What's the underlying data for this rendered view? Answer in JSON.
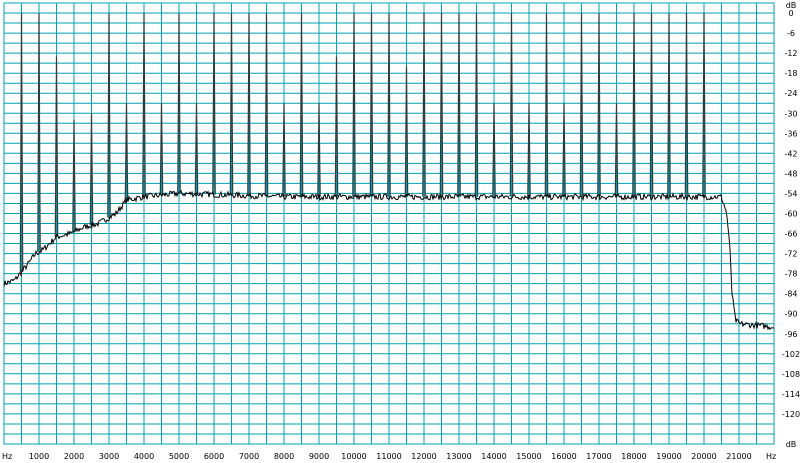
{
  "chart_data": {
    "type": "line",
    "title": "",
    "xlabel": "Hz",
    "ylabel": "dB",
    "x_unit_left": "Hz",
    "x_unit_right": "Hz",
    "y_unit_top": "dB",
    "y_unit_bottom": "dB",
    "xlim": [
      0,
      22000
    ],
    "ylim": [
      -129,
      3
    ],
    "x_ticks": [
      1000,
      2000,
      3000,
      4000,
      5000,
      6000,
      7000,
      8000,
      9000,
      10000,
      11000,
      12000,
      13000,
      14000,
      15000,
      16000,
      17000,
      18000,
      19000,
      20000,
      21000
    ],
    "x_tick_labels": [
      "1000",
      "2000",
      "3000",
      "4000",
      "5000",
      "6000",
      "7000",
      "8000",
      "9000",
      "10000",
      "11000",
      "12000",
      "13000",
      "14000",
      "15000",
      "16000",
      "17000",
      "18000",
      "19000",
      "20000",
      "21000"
    ],
    "y_ticks": [
      0,
      -6,
      -12,
      -18,
      -24,
      -30,
      -36,
      -42,
      -48,
      -54,
      -60,
      -66,
      -72,
      -78,
      -84,
      -90,
      -96,
      -102,
      -108,
      -114,
      -120
    ],
    "y_tick_labels": [
      "0",
      "-6",
      "-12",
      "-18",
      "-24",
      "-30",
      "-36",
      "-42",
      "-48",
      "-54",
      "-60",
      "-66",
      "-72",
      "-78",
      "-84",
      "-90",
      "-96",
      "-102",
      "-108",
      "-114",
      "-120"
    ],
    "grid": true,
    "colors": {
      "grid": "#00a0b4",
      "line": "#000000",
      "peak": "#283c3c",
      "background": "#ffffff"
    },
    "noise_floor": {
      "x": [
        0,
        300,
        700,
        900,
        1100,
        1500,
        1900,
        2300,
        2700,
        3200,
        3500,
        4000,
        5000,
        8000,
        12000,
        16000,
        20000,
        20500,
        20650,
        20750,
        20800,
        20900,
        21000,
        22000
      ],
      "y": [
        -81,
        -80,
        -75,
        -72,
        -71,
        -67,
        -66,
        -64,
        -63,
        -60,
        -56,
        -55,
        -54,
        -55,
        -55,
        -55,
        -55,
        -55,
        -60,
        -72,
        -84,
        -92,
        -93,
        -94
      ]
    },
    "series": [
      {
        "x": [
          500,
          1000,
          1500,
          2000,
          2500,
          3000,
          3500,
          4000,
          4500,
          5000,
          5500,
          6000,
          6500,
          7000,
          7500,
          8000,
          8500,
          9000,
          9500,
          10000,
          10500,
          11000,
          11500,
          12000,
          12500,
          13000,
          13500,
          14000,
          14500,
          15000,
          15500,
          16000,
          16500,
          17000,
          17500,
          18000,
          18500,
          19000,
          19500,
          20000
        ],
        "y": [
          0,
          0,
          -13,
          -32,
          -30,
          0,
          -27,
          0,
          -27,
          0,
          -27,
          0,
          0,
          0,
          0,
          -27,
          0,
          -27,
          -13,
          0,
          0,
          0,
          -16,
          0,
          0,
          0,
          0,
          -27,
          0,
          -27,
          0,
          -27,
          0,
          0,
          -27,
          0,
          0,
          0,
          0,
          0
        ]
      }
    ]
  }
}
